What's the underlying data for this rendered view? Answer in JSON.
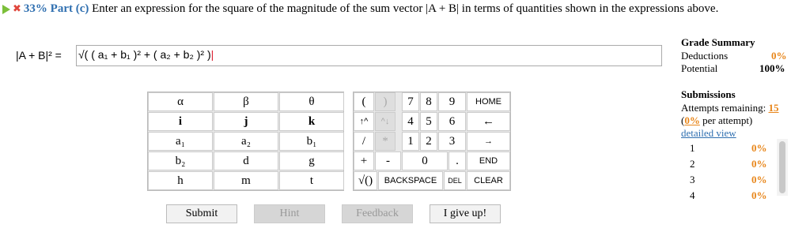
{
  "header": {
    "percent_part": "33% Part (c)",
    "prompt": "Enter an expression for the square of the magnitude of the sum vector |A + B| in terms of quantities shown in the expressions above."
  },
  "expression": {
    "label": "|A + B|² =",
    "value": "√( ( a₁ + b₁ )² + ( a₂ + b₂ )² )"
  },
  "symbols_grid": [
    [
      "α",
      "β",
      "θ"
    ],
    [
      "i",
      "j",
      "k"
    ],
    [
      "a₁",
      "a₂",
      "b₁"
    ],
    [
      "b₂",
      "d",
      "g"
    ],
    [
      "h",
      "m",
      "t"
    ]
  ],
  "numpad": {
    "r1": [
      "(",
      ")",
      "7",
      "8",
      "9",
      "HOME"
    ],
    "r2": [
      "↑^",
      "^↓",
      "4",
      "5",
      "6",
      "←"
    ],
    "r3": [
      "/",
      "*",
      "1",
      "2",
      "3",
      "→"
    ],
    "r4": [
      "+",
      "-",
      "0",
      ".",
      "END"
    ],
    "r5": [
      "√()",
      "BACKSPACE",
      "DEL",
      "CLEAR"
    ]
  },
  "buttons": {
    "submit": "Submit",
    "hint": "Hint",
    "feedback": "Feedback",
    "give_up": "I give up!"
  },
  "grade_summary": {
    "title": "Grade Summary",
    "deductions_label": "Deductions",
    "deductions_value": "0%",
    "potential_label": "Potential",
    "potential_value": "100%"
  },
  "submissions": {
    "title": "Submissions",
    "attempts_label": "Attempts remaining:",
    "attempts_value": "15",
    "per_attempt_pct": "0%",
    "per_attempt_text": "per attempt)",
    "detailed_view": "detailed view",
    "rows": [
      {
        "n": "1",
        "pct": "0%"
      },
      {
        "n": "2",
        "pct": "0%"
      },
      {
        "n": "3",
        "pct": "0%"
      },
      {
        "n": "4",
        "pct": "0%"
      }
    ]
  },
  "colors": {
    "accent_blue": "#2f6fb0",
    "orange": "#e8861a",
    "caret_red": "#d22233",
    "play_green": "#7bbf3a"
  }
}
